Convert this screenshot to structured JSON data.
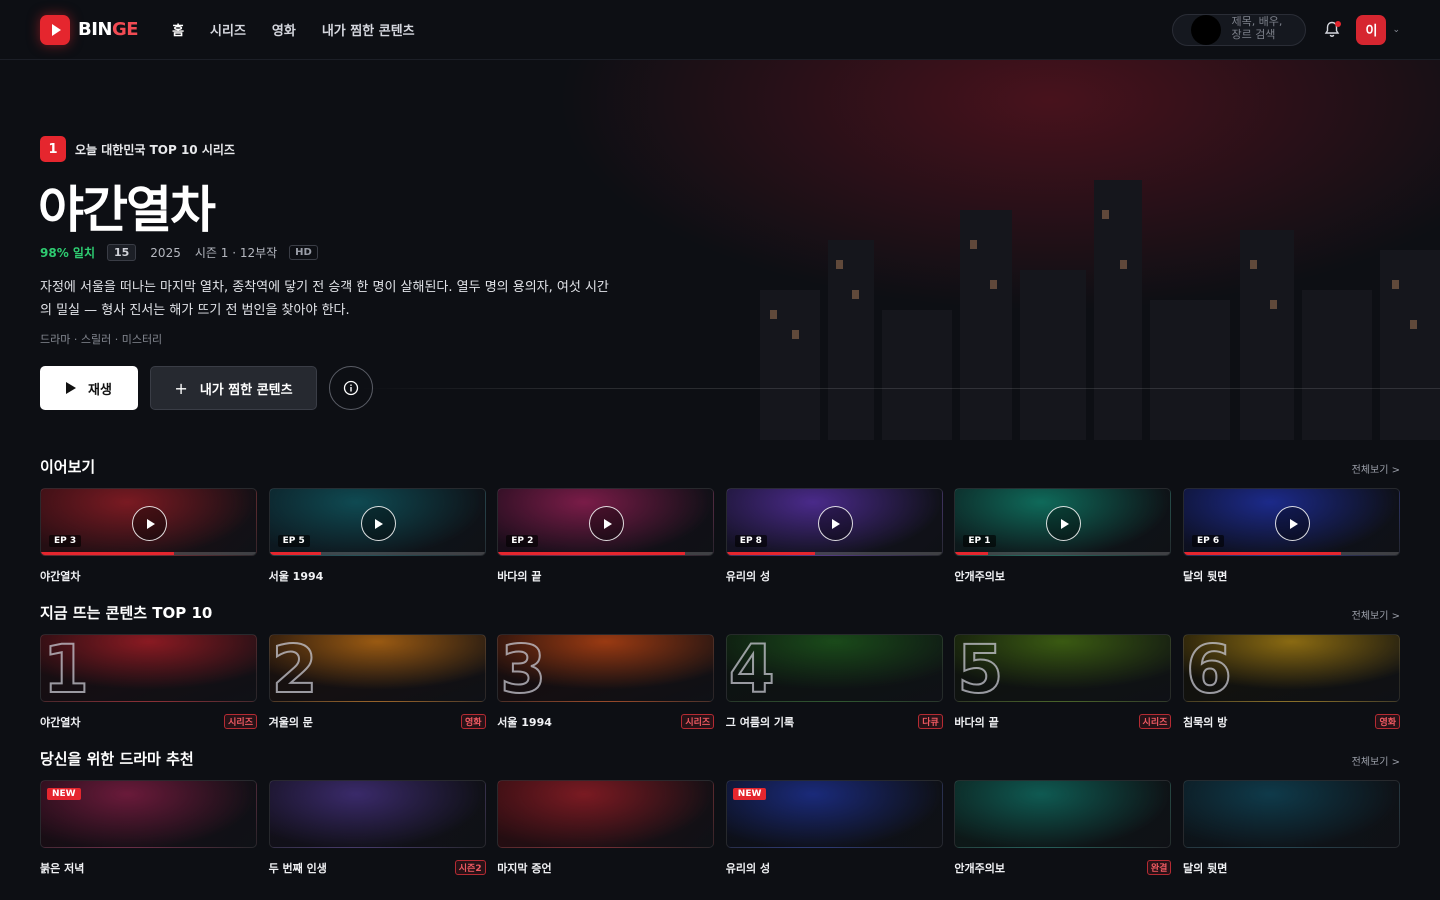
{
  "header": {
    "logo_text": "BINGE",
    "logo_accent": "GE",
    "logo_main": "BIN",
    "nav": [
      {
        "label": "홈"
      },
      {
        "label": "시리즈"
      },
      {
        "label": "영화"
      },
      {
        "label": "내가 찜한 콘텐츠"
      }
    ],
    "search_placeholder": "제목, 배우, 장르 검색",
    "avatar_initial": "이"
  },
  "hero": {
    "rank": "1",
    "rank_label": "오늘 대한민국 TOP 10 시리즈",
    "title": "야간열차",
    "match": "98% 일치",
    "age": "15",
    "year": "2025",
    "season_info": "시즌 1 · 12부작",
    "quality": "HD",
    "description": "자정에 서울을 떠나는 마지막 열차, 종착역에 닿기 전 승객 한 명이 살해된다. 열두 명의 용의자, 여섯 시간의 밀실 — 형사 진서는 해가 뜨기 전 범인을 찾아야 한다.",
    "genres": "드라마 · 스릴러 · 미스터리",
    "play_label": "재생",
    "mylist_label": "내가 찜한 콘텐츠"
  },
  "sections": {
    "continue": {
      "title": "이어보기",
      "see_all": "전체보기 >",
      "items": [
        {
          "title": "야간열차",
          "ep": "EP 3",
          "progress": 0.62,
          "colors": [
            "#7a1a22",
            "#2a0d12"
          ]
        },
        {
          "title": "서울 1994",
          "ep": "EP 5",
          "progress": 0.24,
          "colors": [
            "#0f4a52",
            "#0c1a22"
          ]
        },
        {
          "title": "바다의 끝",
          "ep": "EP 2",
          "progress": 0.87,
          "colors": [
            "#7a1c48",
            "#1a0c1a"
          ]
        },
        {
          "title": "유리의 성",
          "ep": "EP 8",
          "progress": 0.41,
          "colors": [
            "#4a2a8a",
            "#141226"
          ]
        },
        {
          "title": "안개주의보",
          "ep": "EP 1",
          "progress": 0.15,
          "colors": [
            "#0f6a5a",
            "#0c1a1c"
          ]
        },
        {
          "title": "달의 뒷면",
          "ep": "EP 6",
          "progress": 0.73,
          "colors": [
            "#1c2a8a",
            "#0c0f22"
          ]
        }
      ]
    },
    "top10": {
      "title": "지금 뜨는 콘텐츠 TOP 10",
      "see_all": "전체보기 >",
      "items": [
        {
          "rank": "1",
          "title": "야간열차",
          "tag": "시리즈",
          "colors": [
            "#8a1a22",
            "#1a0c10"
          ]
        },
        {
          "rank": "2",
          "title": "겨울의 문",
          "tag": "영화",
          "colors": [
            "#9a5a12",
            "#1a0f0c"
          ]
        },
        {
          "rank": "3",
          "title": "서울 1994",
          "tag": "시리즈",
          "colors": [
            "#9a3a12",
            "#1a0c0c"
          ]
        },
        {
          "rank": "4",
          "title": "그 여름의 기록",
          "tag": "다큐",
          "colors": [
            "#1a4a1a",
            "#0c140f"
          ]
        },
        {
          "rank": "5",
          "title": "바다의 끝",
          "tag": "시리즈",
          "colors": [
            "#3a5a12",
            "#0f140c"
          ]
        },
        {
          "rank": "6",
          "title": "침묵의 방",
          "tag": "영화",
          "colors": [
            "#8a6a12",
            "#141208"
          ]
        }
      ]
    },
    "drama": {
      "title": "당신을 위한 드라마 추천",
      "see_all": "전체보기 >",
      "items": [
        {
          "title": "붉은 저녁",
          "badge": "NEW",
          "tag": "",
          "colors": [
            "#6a1a3a",
            "#1a0c14"
          ]
        },
        {
          "title": "두 번째 인생",
          "badge": "",
          "tag": "시즌2",
          "colors": [
            "#3a2a6a",
            "#120f1a"
          ]
        },
        {
          "title": "마지막 증언",
          "badge": "",
          "tag": "",
          "colors": [
            "#7a1a22",
            "#2a0c10"
          ]
        },
        {
          "title": "유리의 성",
          "badge": "NEW",
          "tag": "",
          "colors": [
            "#1a2a7a",
            "#0c0f1a"
          ]
        },
        {
          "title": "안개주의보",
          "badge": "",
          "tag": "완결",
          "colors": [
            "#0f5a52",
            "#0c1a18"
          ]
        },
        {
          "title": "달의 뒷면",
          "badge": "",
          "tag": "",
          "colors": [
            "#0f3a4a",
            "#0c141a"
          ]
        }
      ]
    }
  },
  "colors": {
    "accent": "#e5262e",
    "background": "#0d0f14",
    "match": "#2ecc71"
  }
}
